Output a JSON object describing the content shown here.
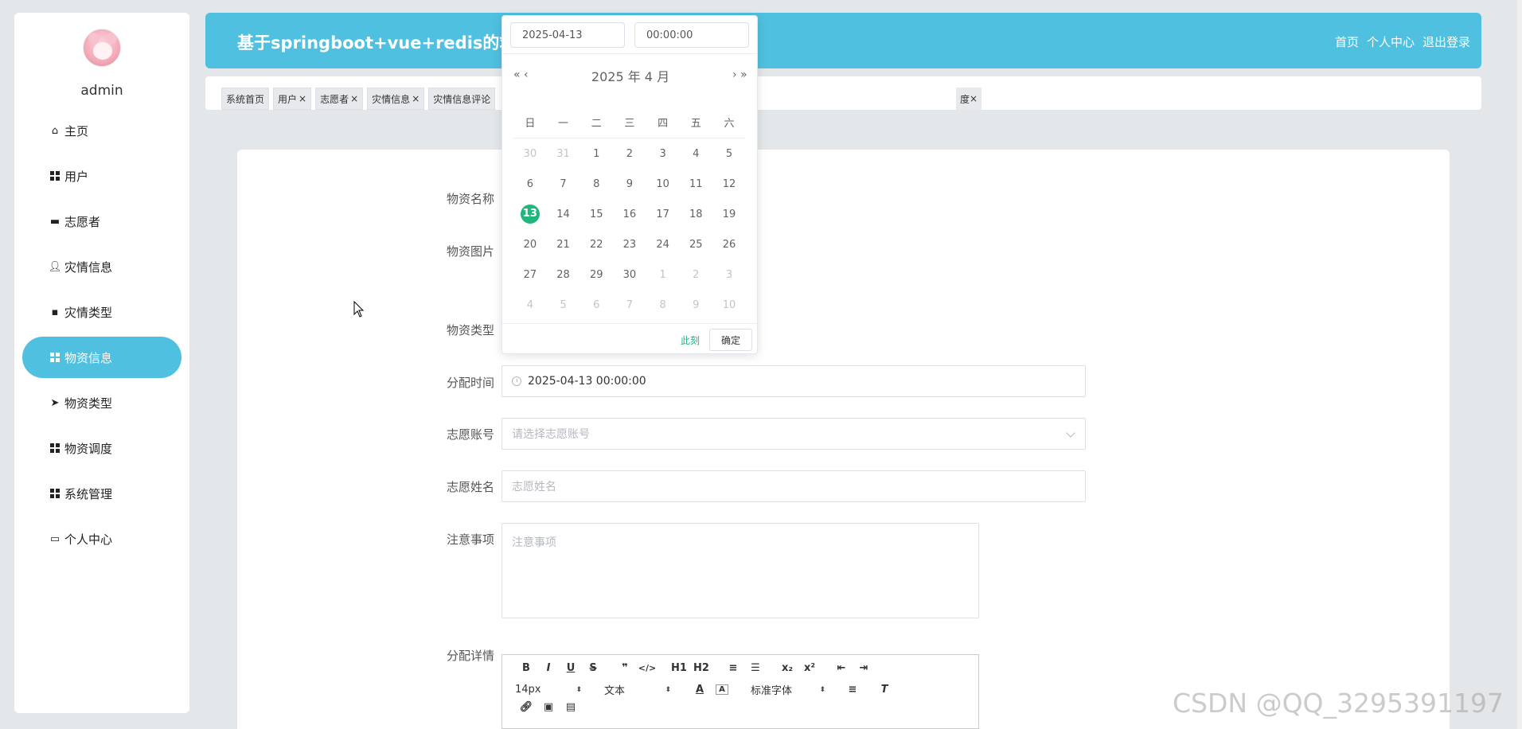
{
  "sidebar": {
    "username": "admin",
    "items": [
      {
        "label": "主页",
        "icon": "home-icon"
      },
      {
        "label": "用户",
        "icon": "grid-icon"
      },
      {
        "label": "志愿者",
        "icon": "monitor-icon"
      },
      {
        "label": "灾情信息",
        "icon": "user-icon"
      },
      {
        "label": "灾情类型",
        "icon": "chat-icon"
      },
      {
        "label": "物资信息",
        "icon": "grid-icon",
        "active": true
      },
      {
        "label": "物资类型",
        "icon": "send-icon"
      },
      {
        "label": "物资调度",
        "icon": "grid-icon"
      },
      {
        "label": "系统管理",
        "icon": "grid-icon"
      },
      {
        "label": "个人中心",
        "icon": "card-icon"
      }
    ]
  },
  "header": {
    "title": "基于springboot+vue+redis的救灾",
    "links": [
      "首页",
      "个人中心",
      "退出登录"
    ]
  },
  "tags": [
    "系统首页",
    "用户",
    "志愿者",
    "灾情信息",
    "灾情信息评论"
  ],
  "tag_end": "度",
  "form": {
    "labels": {
      "name": "物资名称",
      "image": "物资图片",
      "type": "物资类型",
      "time": "分配时间",
      "account": "志愿账号",
      "volunteer_name": "志愿姓名",
      "notes": "注意事项",
      "details": "分配详情"
    },
    "time_value": "2025-04-13 00:00:00",
    "account_placeholder": "请选择志愿账号",
    "volunteer_name_placeholder": "志愿姓名",
    "notes_placeholder": "注意事项"
  },
  "editor": {
    "row1": [
      "B",
      "I",
      "U",
      "S",
      "❞",
      "</>",
      "H1",
      "H2",
      "≡",
      "☰",
      "x₂",
      "x²",
      "⇤",
      "⇥"
    ],
    "font_size": "14px",
    "text_type": "文本",
    "font_family": "标准字体"
  },
  "picker": {
    "date_input": "2025-04-13",
    "time_input": "00:00:00",
    "title": "2025 年  4 月",
    "weekdays": [
      "日",
      "一",
      "二",
      "三",
      "四",
      "五",
      "六"
    ],
    "weeks": [
      [
        [
          "30",
          "m"
        ],
        [
          "31",
          "m"
        ],
        [
          "1",
          ""
        ],
        [
          "2",
          ""
        ],
        [
          "3",
          ""
        ],
        [
          "4",
          ""
        ],
        [
          "5",
          ""
        ]
      ],
      [
        [
          "6",
          ""
        ],
        [
          "7",
          ""
        ],
        [
          "8",
          ""
        ],
        [
          "9",
          ""
        ],
        [
          "10",
          ""
        ],
        [
          "11",
          ""
        ],
        [
          "12",
          ""
        ]
      ],
      [
        [
          "13",
          "t"
        ],
        [
          "14",
          ""
        ],
        [
          "15",
          ""
        ],
        [
          "16",
          ""
        ],
        [
          "17",
          ""
        ],
        [
          "18",
          ""
        ],
        [
          "19",
          ""
        ]
      ],
      [
        [
          "20",
          ""
        ],
        [
          "21",
          ""
        ],
        [
          "22",
          ""
        ],
        [
          "23",
          ""
        ],
        [
          "24",
          ""
        ],
        [
          "25",
          ""
        ],
        [
          "26",
          ""
        ]
      ],
      [
        [
          "27",
          ""
        ],
        [
          "28",
          ""
        ],
        [
          "29",
          ""
        ],
        [
          "30",
          ""
        ],
        [
          "1",
          "m"
        ],
        [
          "2",
          "m"
        ],
        [
          "3",
          "m"
        ]
      ],
      [
        [
          "4",
          "m"
        ],
        [
          "5",
          "m"
        ],
        [
          "6",
          "m"
        ],
        [
          "7",
          "m"
        ],
        [
          "8",
          "m"
        ],
        [
          "9",
          "m"
        ],
        [
          "10",
          "m"
        ]
      ]
    ],
    "now_label": "此刻",
    "ok_label": "确定"
  },
  "watermark": "CSDN @QQ_3295391197",
  "colors": {
    "accent": "#4fc0df",
    "today": "#21b67c"
  }
}
